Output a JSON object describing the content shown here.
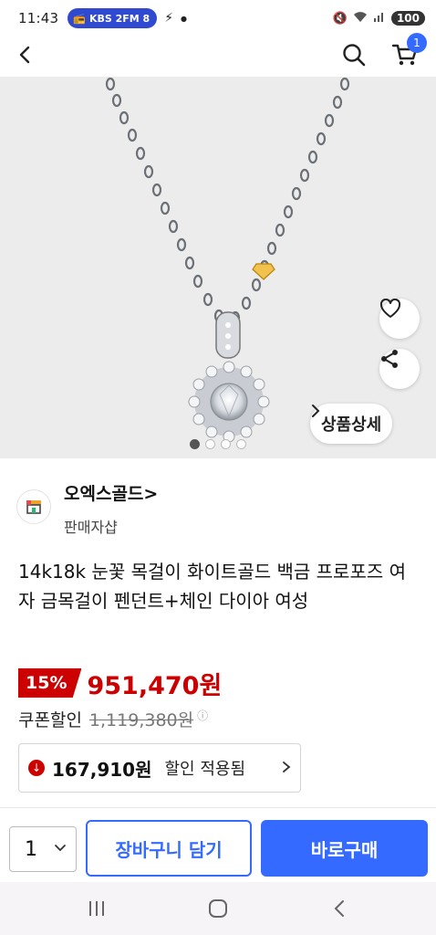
{
  "status_bar": {
    "time": "11:43",
    "radio_label": "KBS 2FM 8",
    "battery": "100"
  },
  "app_bar": {
    "cart_count": "1"
  },
  "hero": {
    "detail_button_label": "상품상세",
    "image_count": 4,
    "active_image": 1
  },
  "seller": {
    "name": "오엑스골드>",
    "subtitle": "판매자샵"
  },
  "product": {
    "title": "14k18k 눈꽃 목걸이 화이트골드 백금 프로포즈 여자 금목걸이 펜던트+체인 다이아 여성",
    "discount_rate": "15%",
    "price": "951,470원",
    "coupon_label": "쿠폰할인",
    "original_price": "1,119,380원",
    "coupon_amount": "167,910원",
    "coupon_applied_text": "할인 적용됨"
  },
  "bottom_bar": {
    "quantity": "1",
    "add_to_cart_label": "장바구니 담기",
    "buy_now_label": "바로구매"
  },
  "colors": {
    "accent_blue": "#346aff",
    "sale_red": "#cc0000",
    "radio_pill": "#2f49d1"
  }
}
